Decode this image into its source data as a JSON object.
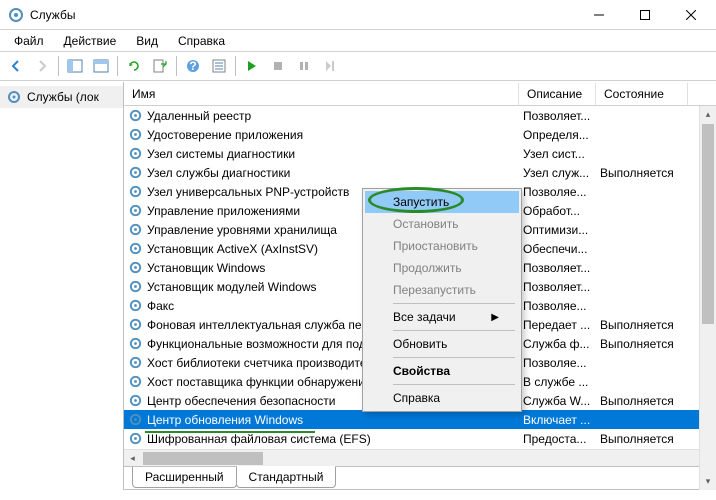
{
  "window": {
    "title": "Службы"
  },
  "menu": {
    "file": "Файл",
    "action": "Действие",
    "view": "Вид",
    "help": "Справка"
  },
  "tree": {
    "root": "Службы (лок"
  },
  "columns": {
    "name": "Имя",
    "desc": "Описание",
    "state": "Состояние"
  },
  "services": [
    {
      "name": "Удаленный реестр",
      "desc": "Позволяет...",
      "state": ""
    },
    {
      "name": "Удостоверение приложения",
      "desc": "Определя...",
      "state": ""
    },
    {
      "name": "Узел системы диагностики",
      "desc": "Узел сист...",
      "state": ""
    },
    {
      "name": "Узел службы диагностики",
      "desc": "Узел служ...",
      "state": "Выполняется"
    },
    {
      "name": "Узел универсальных PNP-устройств",
      "desc": "Позволяе...",
      "state": ""
    },
    {
      "name": "Управление приложениями",
      "desc": "Обработ...",
      "state": ""
    },
    {
      "name": "Управление уровнями хранилища",
      "desc": "Оптимизи...",
      "state": ""
    },
    {
      "name": "Установщик ActiveX (AxInstSV)",
      "desc": "Обеспечи...",
      "state": ""
    },
    {
      "name": "Установщик Windows",
      "desc": "Позволяет...",
      "state": ""
    },
    {
      "name": "Установщик модулей Windows",
      "desc": "Позволяет...",
      "state": ""
    },
    {
      "name": "Факс",
      "desc": "Позволяе...",
      "state": ""
    },
    {
      "name": "Фоновая интеллектуальная служба пере",
      "desc": "Передает ...",
      "state": "Выполняется"
    },
    {
      "name": "Функциональные возможности для подк",
      "desc": "Служба ф...",
      "state": "Выполняется"
    },
    {
      "name": "Хост библиотеки счетчика производите",
      "desc": "Позволяе...",
      "state": ""
    },
    {
      "name": "Хост поставщика функции обнаружени",
      "desc": "В службе ...",
      "state": ""
    },
    {
      "name": "Центр обеспечения безопасности",
      "desc": "Служба W...",
      "state": "Выполняется"
    },
    {
      "name": "Центр обновления Windows",
      "desc": "Включает ...",
      "state": "",
      "selected": true
    },
    {
      "name": "Шифрованная файловая система (EFS)",
      "desc": "Предоста...",
      "state": "Выполняется"
    }
  ],
  "context_menu": {
    "start": "Запустить",
    "stop": "Остановить",
    "pause": "Приостановить",
    "resume": "Продолжить",
    "restart": "Перезапустить",
    "all_tasks": "Все задачи",
    "refresh": "Обновить",
    "properties": "Свойства",
    "help": "Справка"
  },
  "tabs": {
    "extended": "Расширенный",
    "standard": "Стандартный"
  }
}
